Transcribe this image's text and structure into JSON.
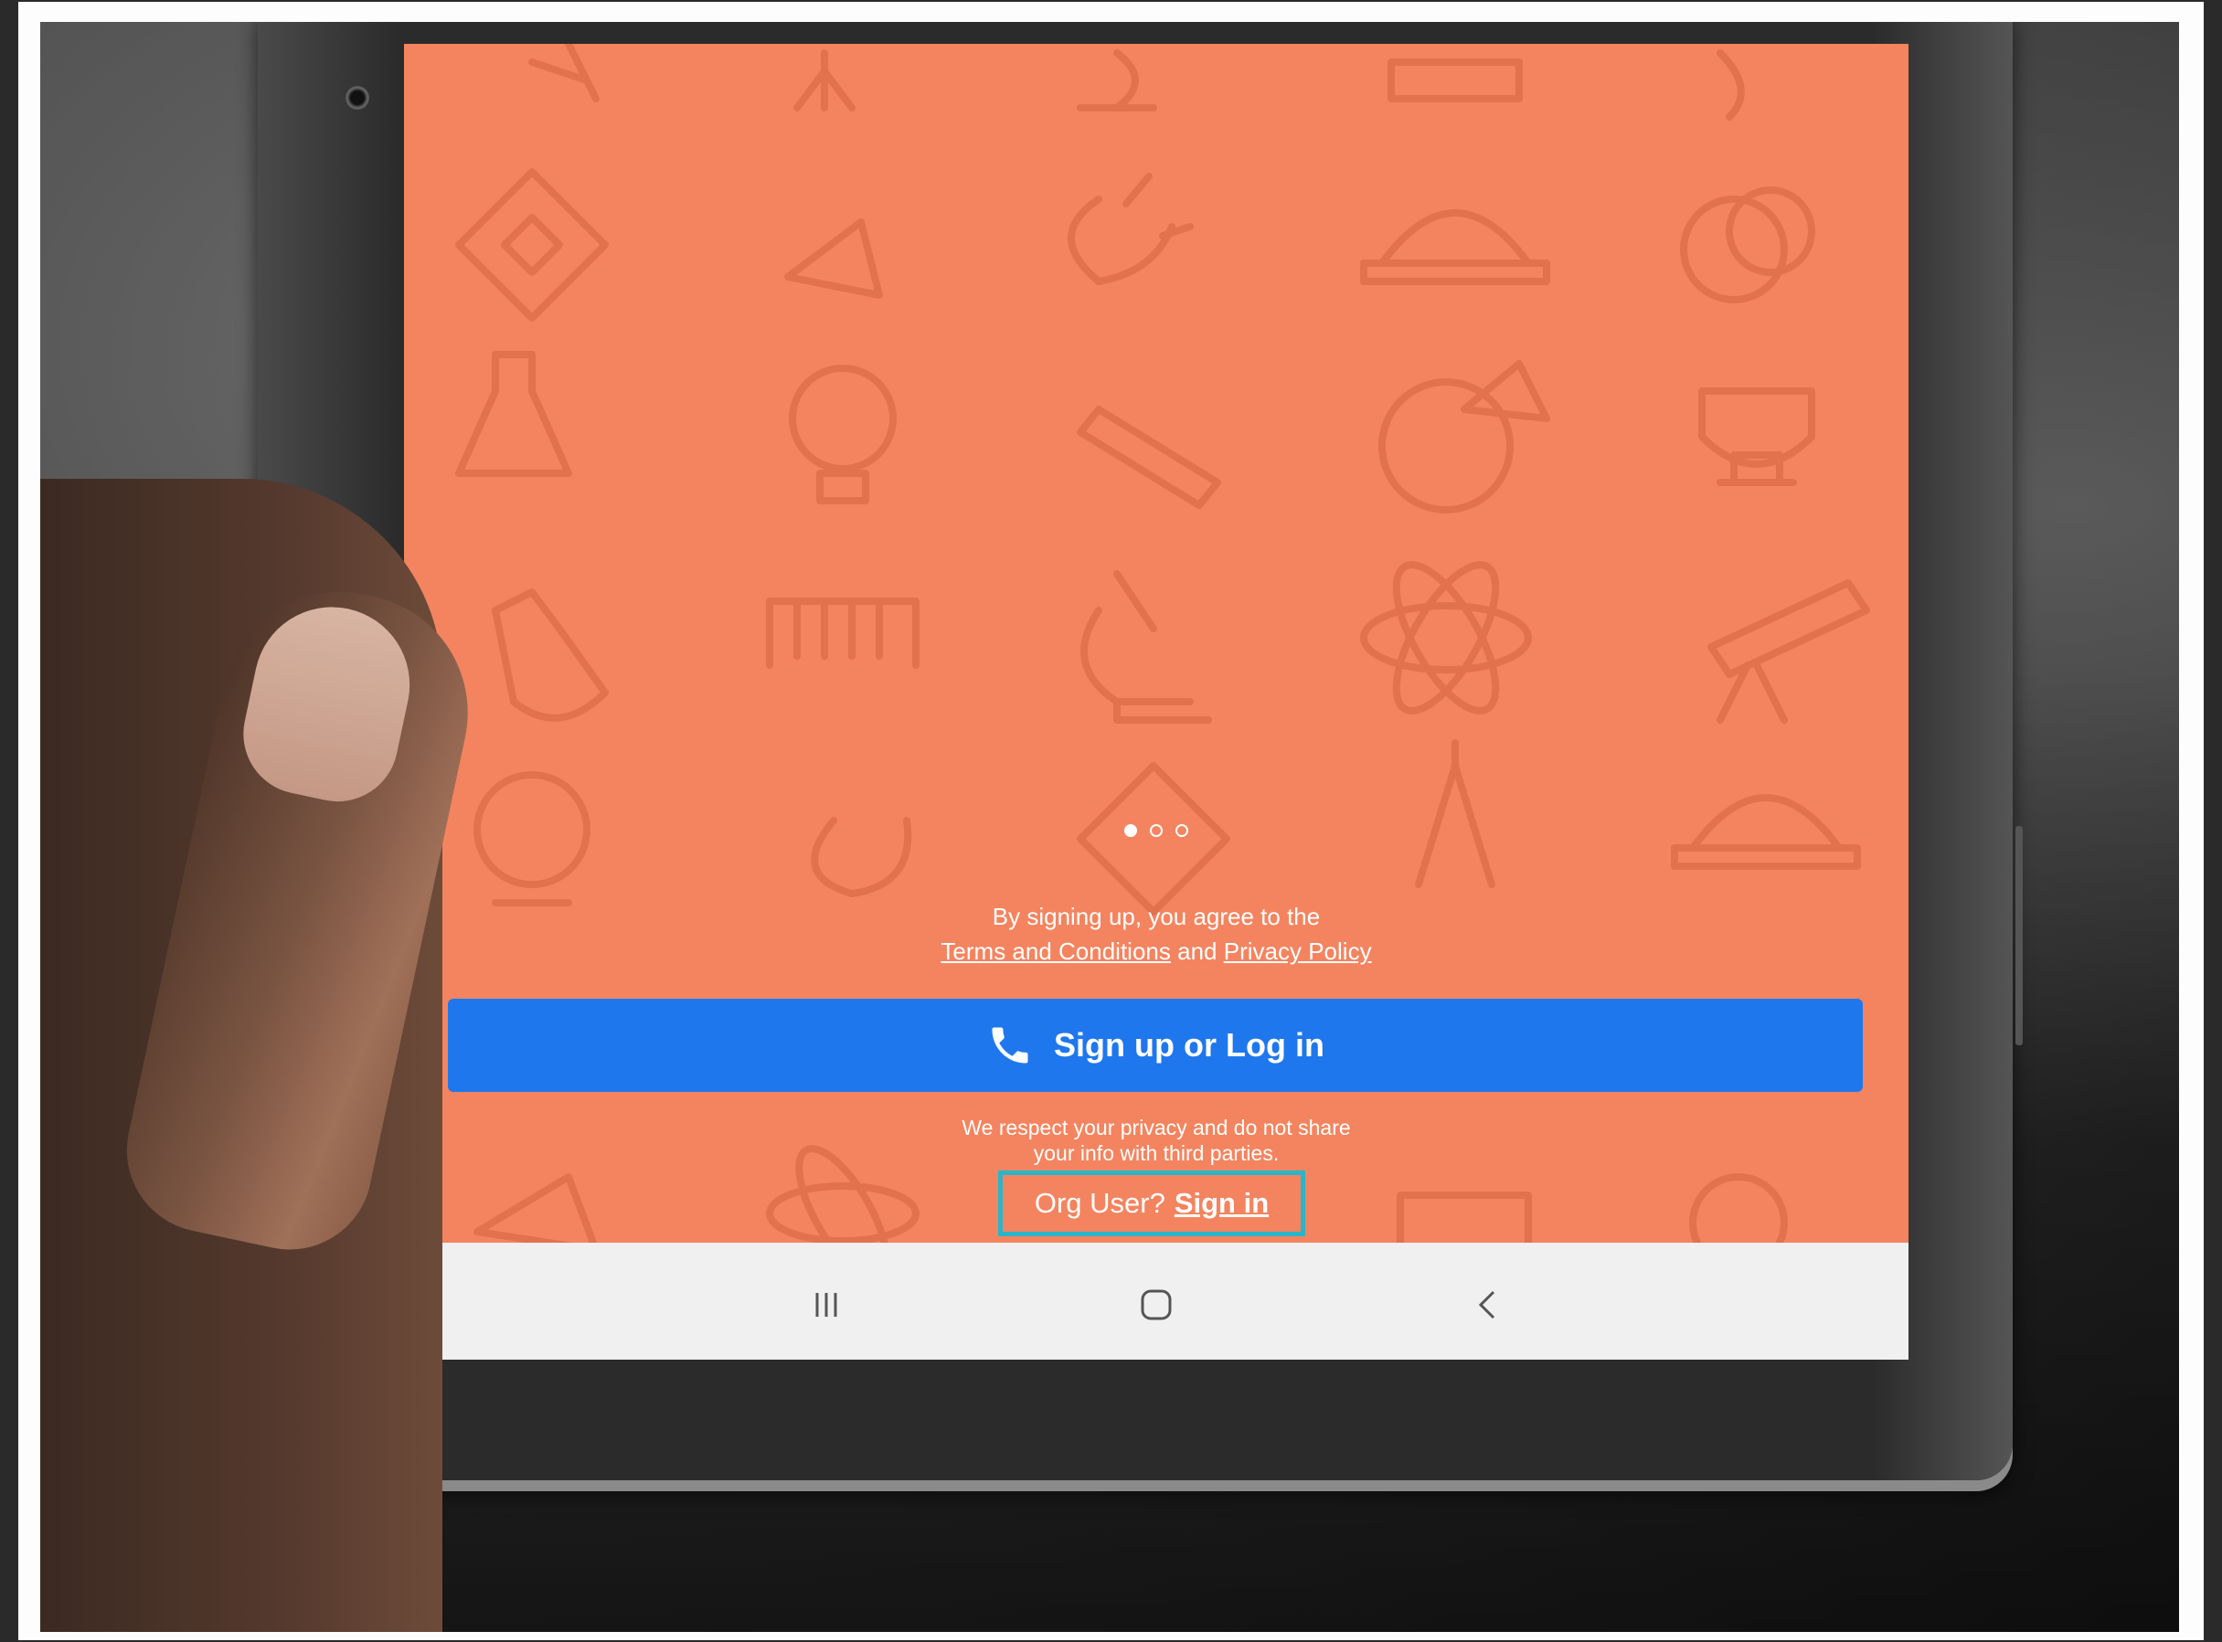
{
  "carousel": {
    "count": 3,
    "active": 0
  },
  "terms": {
    "line1": "By signing up, you agree to the",
    "terms_link": "Terms and Conditions",
    "and": "and",
    "privacy_link": "Privacy Policy"
  },
  "cta": {
    "label": "Sign up or Log in",
    "icon": "phone-icon"
  },
  "privacy_note": {
    "line1": "We respect your privacy and do not share",
    "line2": "your info with third parties."
  },
  "org": {
    "prompt": "Org User?",
    "signin": "Sign in"
  },
  "navbar": {
    "recent": "recent-apps-icon",
    "home": "home-icon",
    "back": "back-icon"
  },
  "colors": {
    "background": "#f4845f",
    "pattern": "#e2714e",
    "cta": "#1f77ee",
    "highlight": "#2bb5c9",
    "navbar": "#f0f0f0"
  }
}
